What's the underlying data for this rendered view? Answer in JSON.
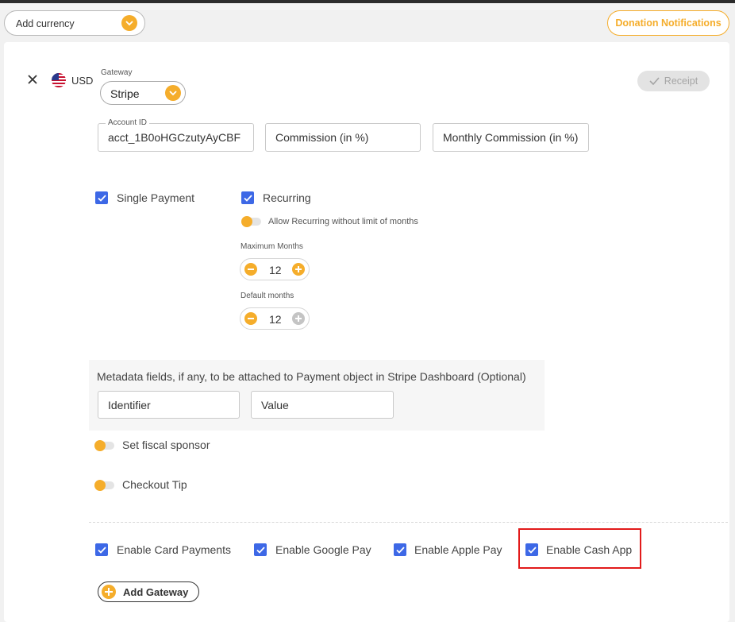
{
  "header": {
    "add_currency_label": "Add currency",
    "donation_notifications_label": "Donation Notifications"
  },
  "gateway_card": {
    "currency": "USD",
    "gateway_label": "Gateway",
    "gateway_value": "Stripe",
    "receipt_label": "Receipt",
    "account_id_label": "Account ID",
    "account_id_value": "acct_1B0oHGCzutyAyCBF",
    "commission_placeholder": "Commission (in %)",
    "monthly_commission_placeholder": "Monthly Commission (in %)"
  },
  "payments": {
    "single_payment_label": "Single Payment",
    "recurring_label": "Recurring",
    "allow_recurring_label": "Allow Recurring without limit of months",
    "maximum_months_label": "Maximum Months",
    "maximum_months_value": "12",
    "default_months_label": "Default months",
    "default_months_value": "12"
  },
  "metadata": {
    "title": "Metadata fields, if any, to be attached to Payment object in Stripe Dashboard (Optional)",
    "identifier_placeholder": "Identifier",
    "value_placeholder": "Value"
  },
  "toggles": {
    "fiscal_sponsor_label": "Set fiscal sponsor",
    "checkout_tip_label": "Checkout Tip"
  },
  "enable_options": {
    "card_payments": "Enable Card Payments",
    "google_pay": "Enable Google Pay",
    "apple_pay": "Enable Apple Pay",
    "cash_app": "Enable Cash App"
  },
  "footer": {
    "add_gateway_label": "Add Gateway"
  },
  "colors": {
    "accent": "#f5ad2b",
    "checkbox": "#3d68e6",
    "highlight": "#e21b1b"
  }
}
